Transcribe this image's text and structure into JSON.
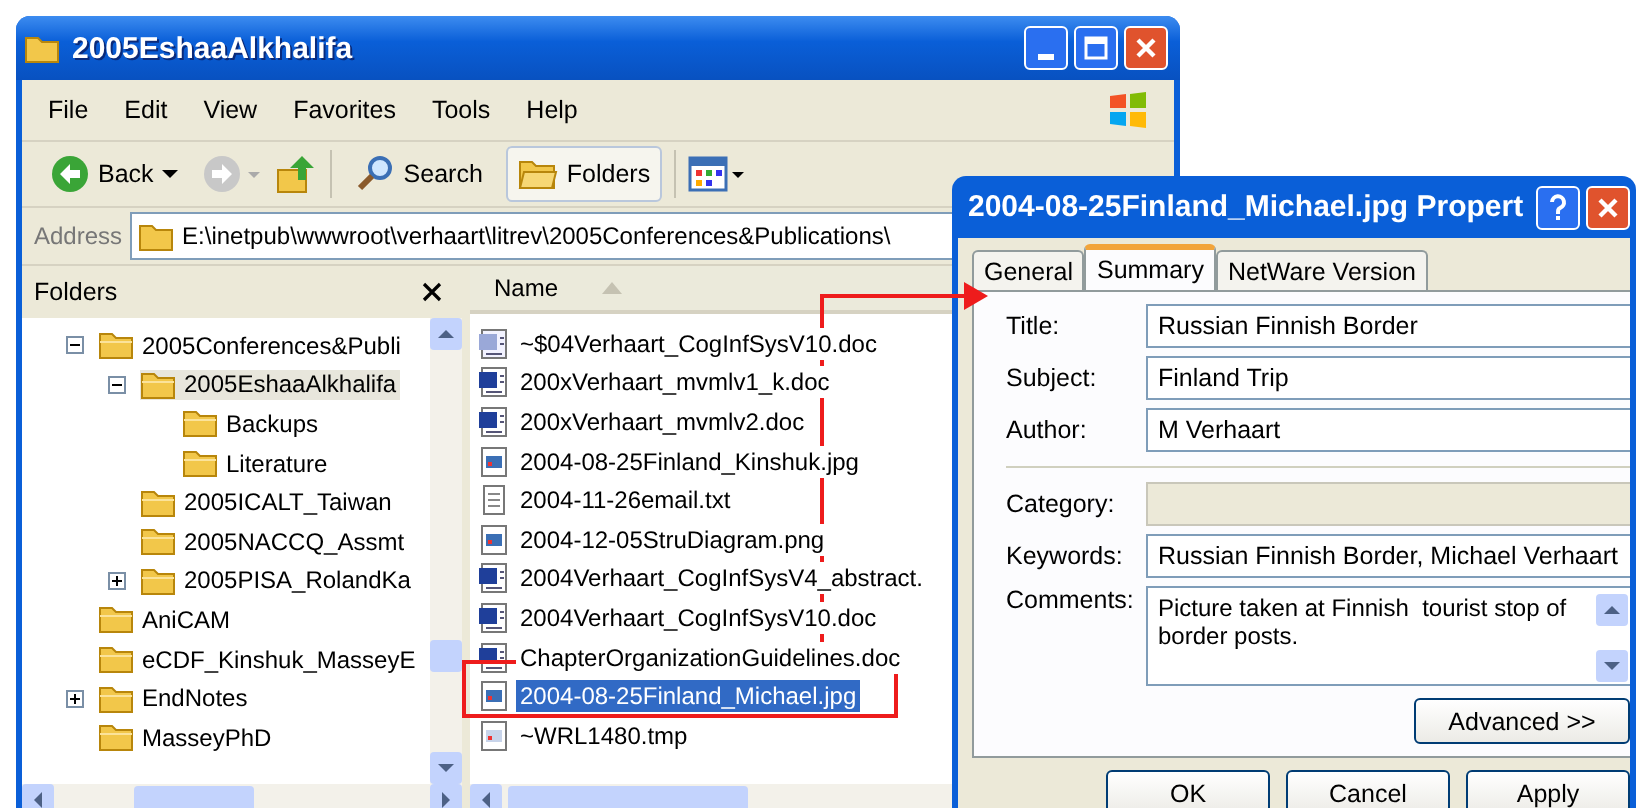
{
  "window": {
    "title": "2005EshaaAlkhalifa"
  },
  "menu": [
    "File",
    "Edit",
    "View",
    "Favorites",
    "Tools",
    "Help"
  ],
  "toolbar": {
    "back": "Back",
    "search": {
      "label": "Search",
      "pressed": false
    },
    "folders": {
      "label": "Folders",
      "pressed": true
    }
  },
  "address": {
    "label": "Address",
    "value": "E:\\inetpub\\wwwroot\\verhaart\\litrev\\2005Conferences&Publications\\"
  },
  "folders_pane": {
    "title": "Folders",
    "tree": [
      {
        "label": "2005Conferences&Publi",
        "expanded": true,
        "selected": false,
        "children": [
          {
            "label": "2005EshaaAlkhalifa",
            "expanded": true,
            "selected": true,
            "children": [
              {
                "label": "Backups",
                "selected": false
              },
              {
                "label": "Literature",
                "selected": false
              }
            ]
          },
          {
            "label": "2005ICALT_Taiwan",
            "selected": false
          },
          {
            "label": "2005NACCQ_Assmt",
            "selected": false
          },
          {
            "label": "2005PISA_RolandKa",
            "expanded": false,
            "selected": false
          }
        ]
      },
      {
        "label": "AniCAM",
        "selected": false
      },
      {
        "label": "eCDF_Kinshuk_MasseyE",
        "selected": false
      },
      {
        "label": "EndNotes",
        "expanded": false,
        "selected": false
      },
      {
        "label": "MasseyPhD",
        "selected": false
      }
    ]
  },
  "files": {
    "column": "Name",
    "items": [
      {
        "name": "~$04Verhaart_CogInfSysV10.doc",
        "kind": "word-temp",
        "selected": false
      },
      {
        "name": "200xVerhaart_mvmlv1_k.doc",
        "kind": "word",
        "selected": false
      },
      {
        "name": "200xVerhaart_mvmlv2.doc",
        "kind": "word",
        "selected": false
      },
      {
        "name": "2004-08-25Finland_Kinshuk.jpg",
        "kind": "image",
        "selected": false
      },
      {
        "name": "2004-11-26email.txt",
        "kind": "text",
        "selected": false
      },
      {
        "name": "2004-12-05StruDiagram.png",
        "kind": "image",
        "selected": false
      },
      {
        "name": "2004Verhaart_CogInfSysV4_abstract.",
        "kind": "word",
        "selected": false
      },
      {
        "name": "2004Verhaart_CogInfSysV10.doc",
        "kind": "word",
        "selected": false
      },
      {
        "name": "ChapterOrganizationGuidelines.doc",
        "kind": "word",
        "selected": false
      },
      {
        "name": "2004-08-25Finland_Michael.jpg",
        "kind": "image",
        "selected": true
      },
      {
        "name": "~WRL1480.tmp",
        "kind": "temp",
        "selected": false
      }
    ]
  },
  "dialog": {
    "title": "2004-08-25Finland_Michael.jpg Propert",
    "tabs": [
      {
        "label": "General",
        "selected": false
      },
      {
        "label": "Summary",
        "selected": true
      },
      {
        "label": "NetWare Version",
        "selected": false
      }
    ],
    "fields": [
      {
        "label": "Title:",
        "value": "Russian Finnish Border",
        "disabled": false
      },
      {
        "label": "Subject:",
        "value": "Finland Trip",
        "disabled": false
      },
      {
        "label": "Author:",
        "value": "M Verhaart",
        "disabled": false
      }
    ],
    "more_fields": [
      {
        "label": "Category:",
        "disabled": true,
        "kind": "line"
      },
      {
        "label": "Keywords:",
        "value": "Russian Finnish Border, Michael Verhaart",
        "disabled": false,
        "kind": "line"
      },
      {
        "label": "Comments:",
        "value": "Picture taken at Finnish  tourist stop of border posts.",
        "disabled": false,
        "kind": "multiline"
      }
    ],
    "advanced": "Advanced >>",
    "buttons": [
      "OK",
      "Cancel",
      "Apply"
    ]
  }
}
